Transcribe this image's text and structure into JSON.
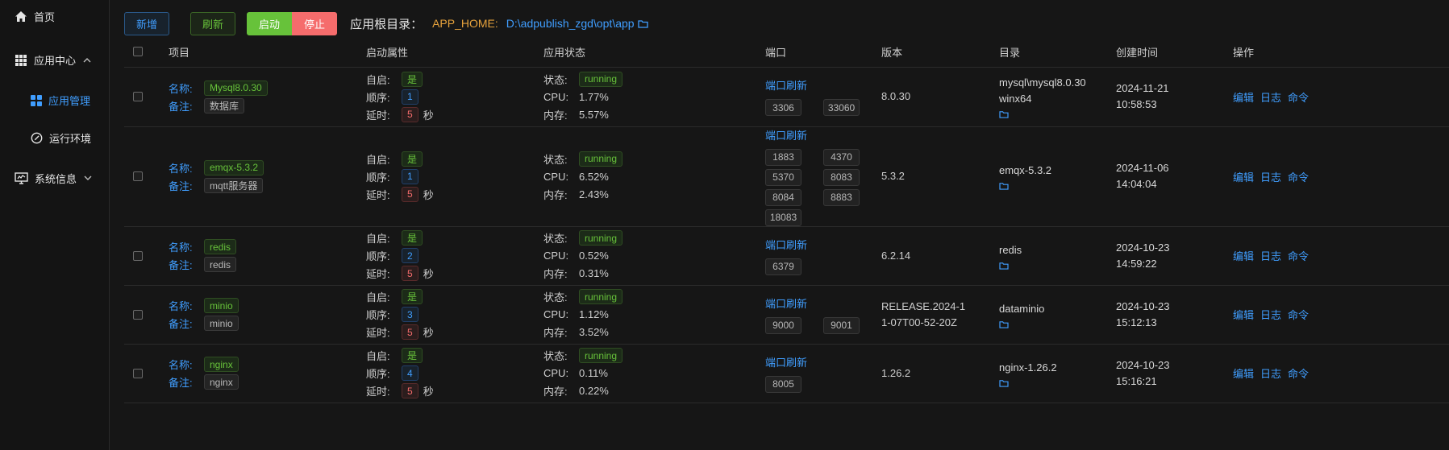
{
  "sidebar": {
    "home": "首页",
    "app_center": "应用中心",
    "app_manage": "应用管理",
    "runtime_env": "运行环境",
    "system_info": "系统信息"
  },
  "toolbar": {
    "add_label": "新增",
    "refresh_label": "刷新",
    "start_label": "启动",
    "stop_label": "停止",
    "root_label": "应用根目录：",
    "root_key": "APP_HOME:",
    "root_path": "D:\\adpublish_zgd\\opt\\app"
  },
  "table": {
    "headers": {
      "project": "项目",
      "start_attr": "启动属性",
      "status": "应用状态",
      "port": "端口",
      "version": "版本",
      "dir": "目录",
      "created": "创建时间",
      "ops": "操作"
    },
    "labels": {
      "name": "名称:",
      "note": "备注:",
      "autostart": "自启:",
      "order": "顺序:",
      "delay": "延时:",
      "seconds": "秒",
      "state": "状态:",
      "cpu": "CPU:",
      "mem": "内存:",
      "port_refresh": "端口刷新",
      "edit": "编辑",
      "log": "日志",
      "cmd": "命令"
    },
    "rows": [
      {
        "name": "Mysql8.0.30",
        "note": "数据库",
        "autostart": "是",
        "order": "1",
        "delay": "5",
        "state": "running",
        "cpu": "1.77%",
        "mem": "5.57%",
        "ports": [
          "3306",
          "33060"
        ],
        "version": "8.0.30",
        "dir": "mysql\\mysql8.0.30 winx64",
        "created": "2024-11-21 10:58:53"
      },
      {
        "name": "emqx-5.3.2",
        "note": "mqtt服务器",
        "autostart": "是",
        "order": "1",
        "delay": "5",
        "state": "running",
        "cpu": "6.52%",
        "mem": "2.43%",
        "ports": [
          "1883",
          "4370",
          "5370",
          "8083",
          "8084",
          "8883",
          "18083"
        ],
        "version": "5.3.2",
        "dir": "emqx-5.3.2",
        "created": "2024-11-06 14:04:04"
      },
      {
        "name": "redis",
        "note": "redis",
        "autostart": "是",
        "order": "2",
        "delay": "5",
        "state": "running",
        "cpu": "0.52%",
        "mem": "0.31%",
        "ports": [
          "6379"
        ],
        "version": "6.2.14",
        "dir": "redis",
        "created": "2024-10-23 14:59:22"
      },
      {
        "name": "minio",
        "note": "minio",
        "autostart": "是",
        "order": "3",
        "delay": "5",
        "state": "running",
        "cpu": "1.12%",
        "mem": "3.52%",
        "ports": [
          "9000",
          "9001"
        ],
        "version": "RELEASE.2024-11-07T00-52-20Z",
        "dir": "dataminio",
        "created": "2024-10-23 15:12:13"
      },
      {
        "name": "nginx",
        "note": "nginx",
        "autostart": "是",
        "order": "4",
        "delay": "5",
        "state": "running",
        "cpu": "0.11%",
        "mem": "0.22%",
        "ports": [
          "8005"
        ],
        "version": "1.26.2",
        "dir": "nginx-1.26.2",
        "created": "2024-10-23 15:16:21"
      }
    ]
  },
  "colors": {
    "accent": "#409eff",
    "success": "#67c23a",
    "danger": "#f56c6c",
    "warning": "#e6a23c"
  }
}
